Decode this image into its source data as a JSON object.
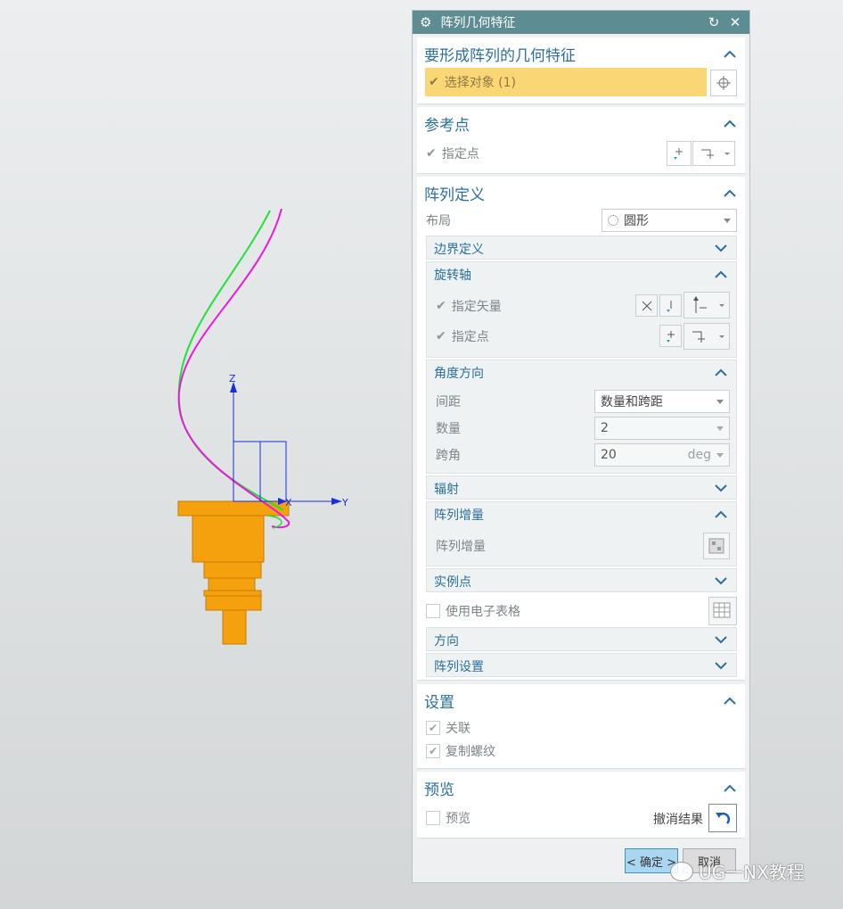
{
  "dialog": {
    "title": "阵列几何特征",
    "icons": [
      "gear-icon",
      "reset-icon",
      "close-icon"
    ]
  },
  "features": {
    "title": "要形成阵列的几何特征",
    "select_label": "选择对象 (1)"
  },
  "reference": {
    "title": "参考点",
    "point_label": "指定点"
  },
  "definition": {
    "title": "阵列定义",
    "layout_label": "布局",
    "layout_value": "圆形",
    "boundary_title": "边界定义",
    "axis": {
      "title": "旋转轴",
      "vector_label": "指定矢量",
      "point_label": "指定点"
    },
    "angle": {
      "title": "角度方向",
      "spacing_label": "间距",
      "spacing_value": "数量和跨距",
      "count_label": "数量",
      "count_value": "2",
      "span_label": "跨角",
      "span_value": "20",
      "span_unit": "deg"
    },
    "radiate_title": "辐射",
    "increment": {
      "title": "阵列增量",
      "label": "阵列增量"
    },
    "instance_title": "实例点",
    "spreadsheet_label": "使用电子表格",
    "orientation_title": "方向",
    "settings_title": "阵列设置"
  },
  "settings": {
    "title": "设置",
    "associative_label": "关联",
    "copy_threads_label": "复制螺纹"
  },
  "preview": {
    "title": "预览",
    "preview_label": "预览",
    "undo_label": "撤消结果"
  },
  "footer": {
    "ok_label": "< 确定 >",
    "cancel_label": "取消"
  },
  "viewport": {
    "axis_z": "Z",
    "axis_x": "X",
    "axis_y": "Y"
  },
  "watermark": "UG一NX教程",
  "colors": {
    "title_bar": "#5d8d92",
    "section_title": "#2b6f9a",
    "selection_highlight": "#fad774",
    "part_orange": "#f5a10e",
    "curve_green": "#22e03a",
    "curve_magenta": "#e81ad9",
    "axis_blue": "#1a2fd6"
  }
}
